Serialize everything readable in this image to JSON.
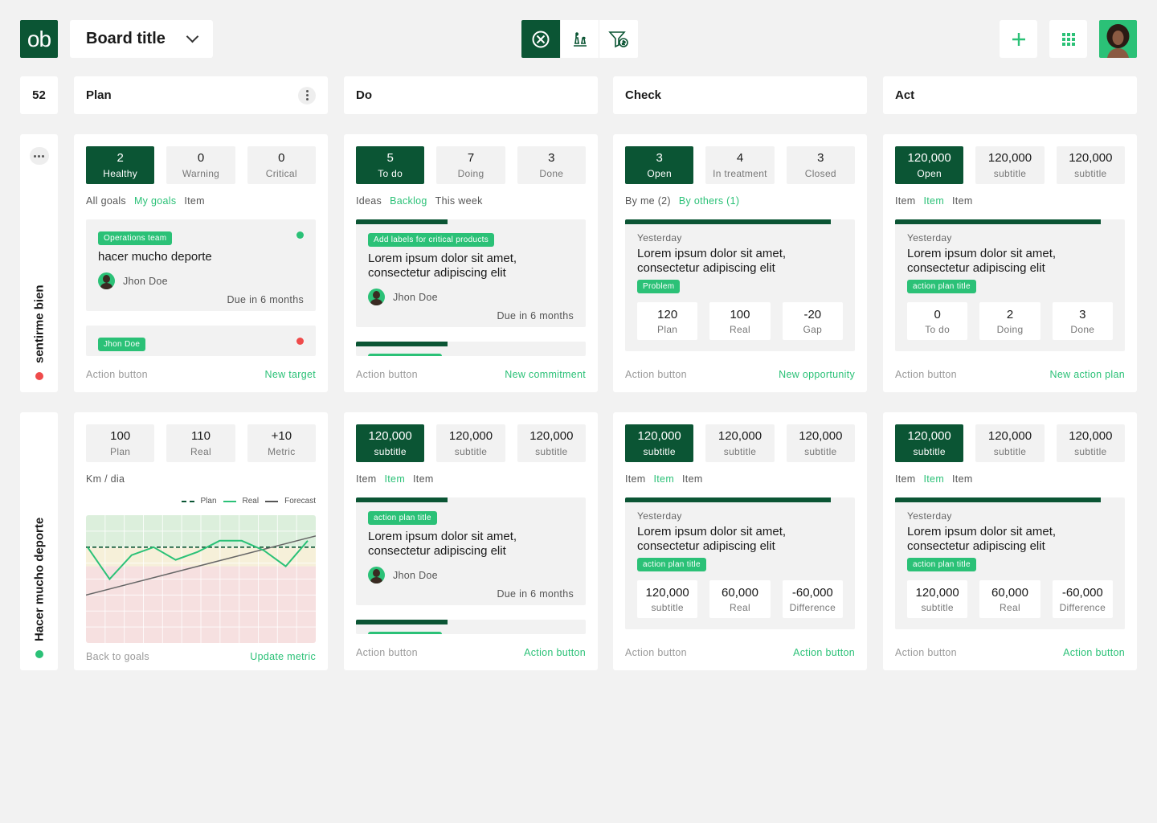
{
  "header": {
    "logo_text": "ob",
    "board_title": "Board title",
    "toolbar_icons": [
      "pdca-cycle-icon",
      "chess-strategy-icon",
      "funnel-money-icon"
    ],
    "add_icon": "plus-icon",
    "apps_icon": "grid-icon",
    "accent_color": "#0b5534",
    "highlight_color": "#2bc177"
  },
  "board": {
    "count": "52",
    "columns": [
      "Plan",
      "Do",
      "Check",
      "Act"
    ]
  },
  "rows": [
    {
      "label": "sentirme bien",
      "status_color": "#ef4b4b"
    },
    {
      "label": "Hacer mucho deporte",
      "status_color": "#2bc177"
    }
  ],
  "r1": {
    "plan": {
      "stats": [
        {
          "n": "2",
          "l": "Healthy"
        },
        {
          "n": "0",
          "l": "Warning"
        },
        {
          "n": "0",
          "l": "Critical"
        }
      ],
      "tabs": [
        "All goals",
        "My goals",
        "Item"
      ],
      "card1": {
        "tag": "Operations team",
        "title": "hacer mucho deporte",
        "person": "Jhon Doe",
        "due": "Due in 6 months",
        "status_color": "#2bc177"
      },
      "card2": {
        "tag": "Jhon Doe",
        "status_color": "#ef4b4b"
      },
      "footer": {
        "left": "Action button",
        "right": "New target"
      }
    },
    "do": {
      "stats": [
        {
          "n": "5",
          "l": "To do"
        },
        {
          "n": "7",
          "l": "Doing"
        },
        {
          "n": "3",
          "l": "Done"
        }
      ],
      "tabs": [
        "Ideas",
        "Backlog",
        "This week"
      ],
      "card1": {
        "tag": "Add labels for critical products",
        "title": "Lorem ipsum dolor sit amet, consectetur adipiscing elit",
        "person": "Jhon Doe",
        "due": "Due in 6 months"
      },
      "footer": {
        "left": "Action button",
        "right": "New commitment"
      }
    },
    "check": {
      "stats": [
        {
          "n": "3",
          "l": "Open"
        },
        {
          "n": "4",
          "l": "In treatment"
        },
        {
          "n": "3",
          "l": "Closed"
        }
      ],
      "tabs": [
        "By me (2)",
        "By others (1)"
      ],
      "card1": {
        "when": "Yesterday",
        "title": "Lorem ipsum dolor sit amet, consectetur adipiscing elit",
        "tag": "Problem",
        "mini": [
          {
            "n": "120",
            "l": "Plan"
          },
          {
            "n": "100",
            "l": "Real"
          },
          {
            "n": "-20",
            "l": "Gap"
          }
        ]
      },
      "footer": {
        "left": "Action button",
        "right": "New opportunity"
      }
    },
    "act": {
      "stats": [
        {
          "n": "120,000",
          "l": "Open"
        },
        {
          "n": "120,000",
          "l": "subtitle"
        },
        {
          "n": "120,000",
          "l": "subtitle"
        }
      ],
      "tabs": [
        "Item",
        "Item",
        "Item"
      ],
      "card1": {
        "when": "Yesterday",
        "title": "Lorem ipsum dolor sit amet, consectetur adipiscing elit",
        "tag": "action plan title",
        "mini": [
          {
            "n": "0",
            "l": "To do"
          },
          {
            "n": "2",
            "l": "Doing"
          },
          {
            "n": "3",
            "l": "Done"
          }
        ]
      },
      "footer": {
        "left": "Action button",
        "right": "New action plan"
      }
    }
  },
  "r2": {
    "plan": {
      "stats": [
        {
          "n": "100",
          "l": "Plan"
        },
        {
          "n": "110",
          "l": "Real"
        },
        {
          "n": "+10",
          "l": "Metric"
        }
      ],
      "unit": "Km / dia",
      "legend": [
        "Plan",
        "Real",
        "Forecast"
      ],
      "footer": {
        "left": "Back to goals",
        "right": "Update metric"
      }
    },
    "do": {
      "stats": [
        {
          "n": "120,000",
          "l": "subtitle"
        },
        {
          "n": "120,000",
          "l": "subtitle"
        },
        {
          "n": "120,000",
          "l": "subtitle"
        }
      ],
      "tabs": [
        "Item",
        "Item",
        "Item"
      ],
      "card1": {
        "tag": "action plan title",
        "title": "Lorem ipsum dolor sit amet, consectetur adipiscing elit",
        "person": "Jhon Doe",
        "due": "Due in 6 months"
      },
      "footer": {
        "left": "Action button",
        "right": "Action button"
      }
    },
    "check": {
      "stats": [
        {
          "n": "120,000",
          "l": "subtitle"
        },
        {
          "n": "120,000",
          "l": "subtitle"
        },
        {
          "n": "120,000",
          "l": "subtitle"
        }
      ],
      "tabs": [
        "Item",
        "Item",
        "Item"
      ],
      "card1": {
        "when": "Yesterday",
        "title": "Lorem ipsum dolor sit amet, consectetur adipiscing elit",
        "tag": "action plan title",
        "mini": [
          {
            "n": "120,000",
            "l": "subtitle"
          },
          {
            "n": "60,000",
            "l": "Real"
          },
          {
            "n": "-60,000",
            "l": "Difference"
          }
        ]
      },
      "footer": {
        "left": "Action button",
        "right": "Action button"
      }
    },
    "act": {
      "stats": [
        {
          "n": "120,000",
          "l": "subtitle"
        },
        {
          "n": "120,000",
          "l": "subtitle"
        },
        {
          "n": "120,000",
          "l": "subtitle"
        }
      ],
      "tabs": [
        "Item",
        "Item",
        "Item"
      ],
      "card1": {
        "when": "Yesterday",
        "title": "Lorem ipsum dolor sit amet, consectetur adipiscing elit",
        "tag": "action plan title",
        "mini": [
          {
            "n": "120,000",
            "l": "subtitle"
          },
          {
            "n": "60,000",
            "l": "Real"
          },
          {
            "n": "-60,000",
            "l": "Difference"
          }
        ]
      },
      "footer": {
        "left": "Action button",
        "right": "Action button"
      }
    }
  },
  "chart_data": {
    "type": "line",
    "x": [
      1,
      2,
      3,
      4,
      5,
      6,
      7,
      8,
      9,
      10,
      11
    ],
    "series": [
      {
        "name": "Plan",
        "values": [
          100,
          100,
          100,
          100,
          100,
          100,
          100,
          100,
          100,
          100,
          100
        ]
      },
      {
        "name": "Real",
        "values": [
          100,
          80,
          95,
          100,
          92,
          97,
          104,
          104,
          98,
          88,
          104
        ]
      },
      {
        "name": "Forecast",
        "values": [
          70,
          74,
          78,
          81,
          85,
          89,
          93,
          96,
          100,
          103,
          107
        ]
      }
    ],
    "ylim": [
      40,
      120
    ],
    "bands": [
      {
        "from": 100,
        "to": 120,
        "color": "#dcefdc"
      },
      {
        "from": 88,
        "to": 100,
        "color": "#f6f0d9"
      },
      {
        "from": 40,
        "to": 88,
        "color": "#f6e0e0"
      }
    ],
    "grid": true
  }
}
